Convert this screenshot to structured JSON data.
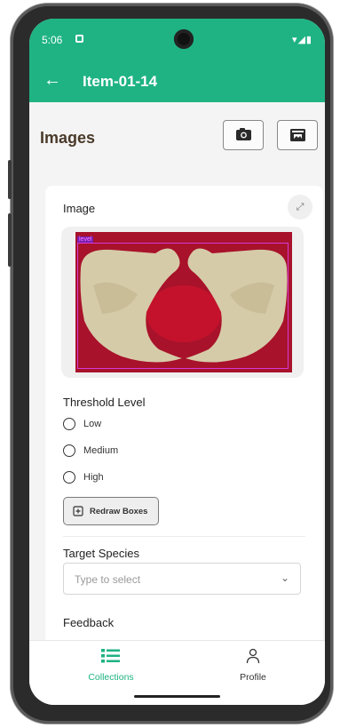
{
  "status_bar": {
    "time": "5:06",
    "system_icons": "▾◢▮"
  },
  "app_bar": {
    "title": "Item-01-14",
    "back_icon": "arrow-left-icon"
  },
  "images_section": {
    "title": "Images",
    "camera_icon": "camera-icon",
    "gallery_icon": "gallery-icon"
  },
  "card": {
    "image_label": "Image",
    "expand_icon": "expand-icon",
    "detection_label": "level",
    "threshold": {
      "title": "Threshold Level",
      "options": [
        "Low",
        "Medium",
        "High"
      ]
    },
    "redraw_label": "Redraw Boxes",
    "target_species": {
      "title": "Target Species",
      "placeholder": "Type to select"
    },
    "feedback_title": "Feedback"
  },
  "nav": {
    "collections_label": "Collections",
    "profile_label": "Profile",
    "accent": "#1fb383"
  }
}
